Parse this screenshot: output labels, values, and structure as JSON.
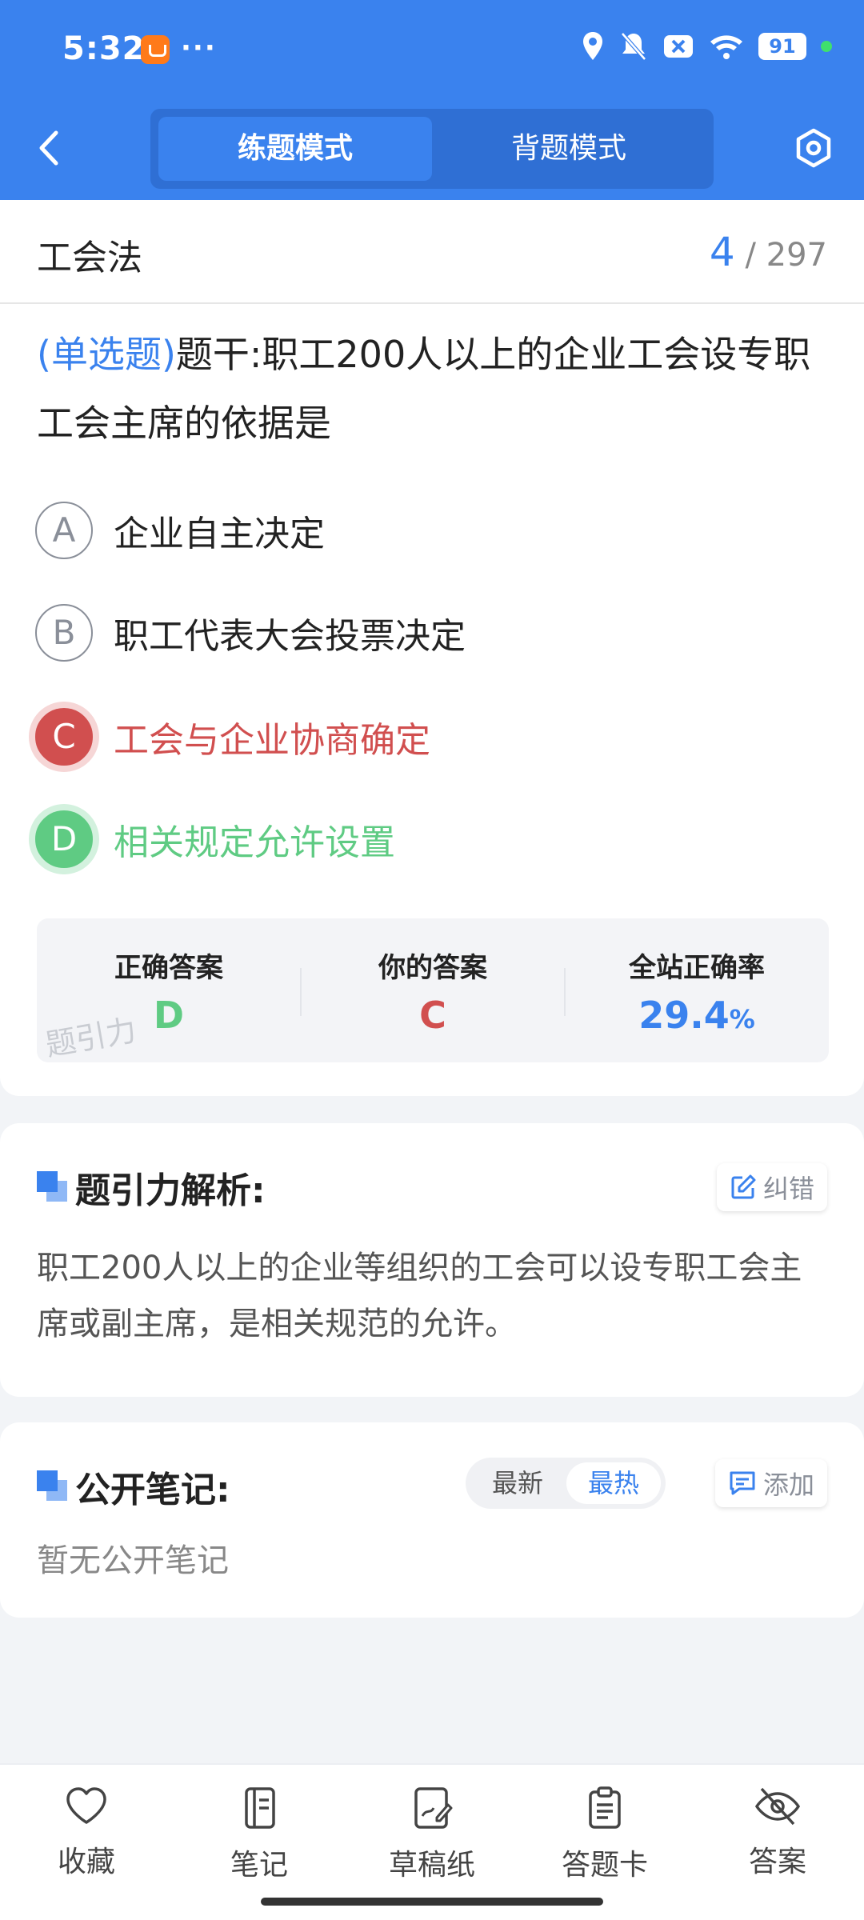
{
  "status_bar": {
    "time": "5:32",
    "dots": "···",
    "battery": "91"
  },
  "header": {
    "mode_tabs": [
      "练题模式",
      "背题模式"
    ],
    "active_tab": 0
  },
  "question": {
    "subject": "工会法",
    "current": "4",
    "total": "/ 297",
    "type_label": "(单选题)",
    "stem": "题干:职工200人以上的企业工会设专职工会主席的依据是",
    "options": [
      {
        "letter": "A",
        "text": "企业自主决定",
        "state": "normal"
      },
      {
        "letter": "B",
        "text": "职工代表大会投票决定",
        "state": "normal"
      },
      {
        "letter": "C",
        "text": "工会与企业协商确定",
        "state": "wrong"
      },
      {
        "letter": "D",
        "text": "相关规定允许设置",
        "state": "correct"
      }
    ]
  },
  "answer_summary": {
    "correct_label": "正确答案",
    "correct_value": "D",
    "yours_label": "你的答案",
    "yours_value": "C",
    "rate_label": "全站正确率",
    "rate_value": "29.4",
    "rate_unit": "%",
    "watermark": "题引力"
  },
  "analysis": {
    "title": "题引力解析:",
    "report_label": "纠错",
    "text": "职工200人以上的企业等组织的工会可以设专职工会主席或副主席，是相关规范的允许。"
  },
  "notes": {
    "title": "公开笔记:",
    "sort_options": [
      "最新",
      "最热"
    ],
    "active_sort": 1,
    "add_label": "添加",
    "empty_text": "暂无公开笔记"
  },
  "bottom_tabs": [
    {
      "label": "收藏",
      "icon": "heart-icon"
    },
    {
      "label": "笔记",
      "icon": "notebook-icon"
    },
    {
      "label": "草稿纸",
      "icon": "draft-icon"
    },
    {
      "label": "答题卡",
      "icon": "clipboard-icon"
    },
    {
      "label": "答案",
      "icon": "eye-off-icon"
    }
  ],
  "colors": {
    "primary": "#3a82ee",
    "wrong": "#d14f4f",
    "correct": "#5fcb83"
  }
}
